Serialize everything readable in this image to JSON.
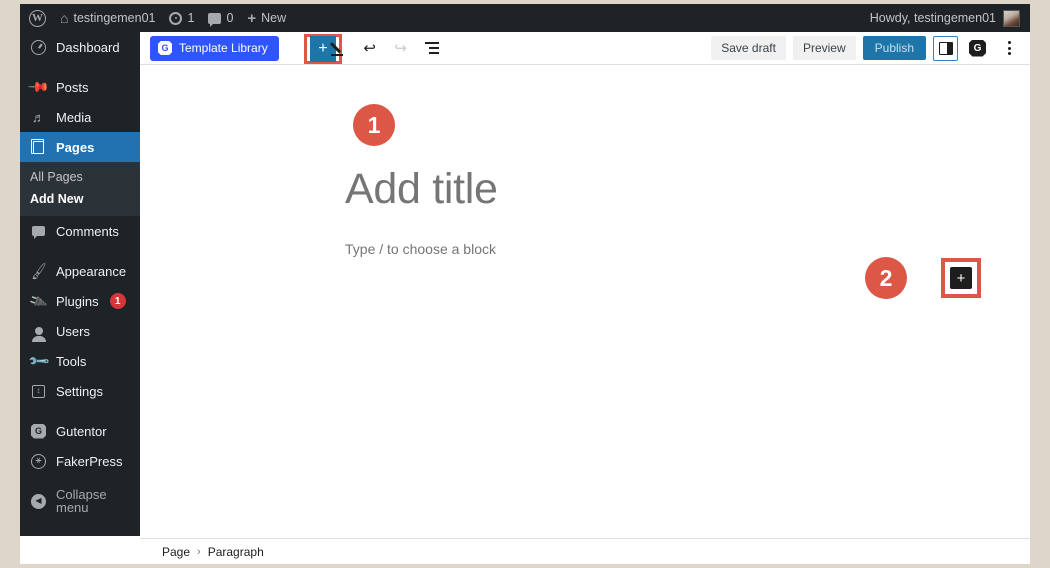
{
  "adminbar": {
    "site_name": "testingemen01",
    "updates_count": "1",
    "comments_count": "0",
    "new_label": "New",
    "howdy": "Howdy, testingemen01",
    "icons": {
      "wp_logo": "W",
      "home": "⌂",
      "plus": "+"
    }
  },
  "sidebar": {
    "items": [
      {
        "label": "Dashboard",
        "icon": "dashboard-icon",
        "current": false
      },
      {
        "label": "Posts",
        "icon": "pin-icon",
        "current": false
      },
      {
        "label": "Media",
        "icon": "media-icon",
        "current": false
      },
      {
        "label": "Pages",
        "icon": "pages-icon",
        "current": true
      },
      {
        "label": "Comments",
        "icon": "comment-icon",
        "current": false
      },
      {
        "label": "Appearance",
        "icon": "brush-icon",
        "current": false
      },
      {
        "label": "Plugins",
        "icon": "plug-icon",
        "current": false,
        "badge": "1"
      },
      {
        "label": "Users",
        "icon": "user-icon",
        "current": false
      },
      {
        "label": "Tools",
        "icon": "wrench-icon",
        "current": false
      },
      {
        "label": "Settings",
        "icon": "settings-icon",
        "current": false
      },
      {
        "label": "Gutentor",
        "icon": "gutentor-icon",
        "current": false
      },
      {
        "label": "FakerPress",
        "icon": "fakerpress-icon",
        "current": false
      },
      {
        "label": "Collapse menu",
        "icon": "collapse-icon",
        "current": false
      }
    ],
    "submenu": [
      {
        "label": "All Pages",
        "current": false
      },
      {
        "label": "Add New",
        "current": true
      }
    ]
  },
  "editor": {
    "template_library_label": "Template Library",
    "add_block_label": "+",
    "toolbar_icons": [
      "pencil-icon",
      "undo-icon",
      "redo-icon",
      "list-view-icon"
    ],
    "save_draft_label": "Save draft",
    "preview_label": "Preview",
    "publish_label": "Publish",
    "settings_sidebar_icon": "sidebar-toggle-icon",
    "gutentor_icon": "gutentor-icon",
    "options_icon": "kebab-menu-icon"
  },
  "canvas": {
    "title_placeholder": "Add title",
    "paragraph_placeholder": "Type / to choose a block",
    "inserter_label": "+"
  },
  "breadcrumb": {
    "items": [
      "Page",
      "Paragraph"
    ],
    "separator": "›"
  },
  "annotations": [
    {
      "id": "marker-1",
      "label": "1"
    },
    {
      "id": "marker-2",
      "label": "2"
    }
  ],
  "colors": {
    "admin_dark": "#1d2327",
    "wp_blue": "#2271b1",
    "publish_blue": "#1e76a8",
    "template_blue": "#2e55ff",
    "marker_red": "#dd5746",
    "badge_red": "#d63638",
    "page_border": "#ded6ca"
  }
}
